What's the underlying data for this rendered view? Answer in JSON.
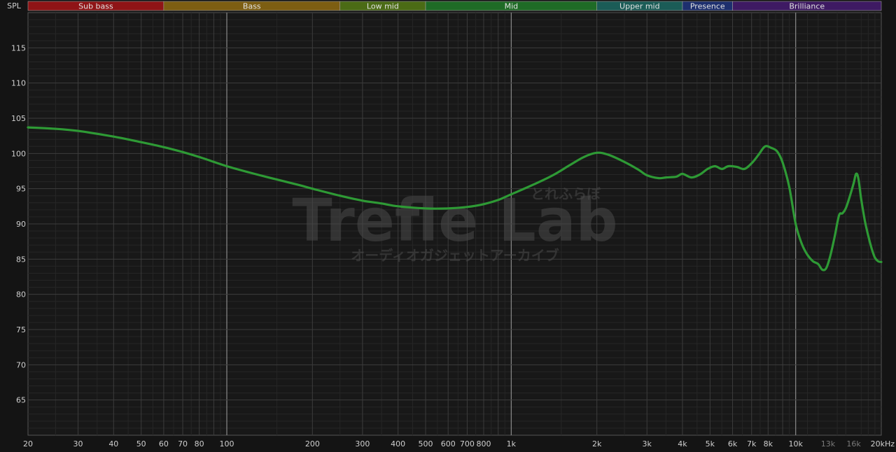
{
  "colors": {
    "background": "#141414",
    "plot_background": "#181818",
    "grid_major": "#3c3c3c",
    "grid_minor": "#262626",
    "decade_line": "#8a8a8a",
    "axis_text": "#cfcfcf",
    "curve": "#2e9a35",
    "watermark": "#4a4a4a"
  },
  "watermark": {
    "title": "Trefle Lab",
    "kana_top": "とれふらぼ",
    "kana_bottom": "オーディオガジェットアーカイブ"
  },
  "bands": [
    {
      "label": "Sub bass",
      "from": 20,
      "to": 60,
      "color": "#8f1416"
    },
    {
      "label": "Bass",
      "from": 60,
      "to": 250,
      "color": "#7d5e12"
    },
    {
      "label": "Low mid",
      "from": 250,
      "to": 500,
      "color": "#4b6b15"
    },
    {
      "label": "Mid",
      "from": 500,
      "to": 2000,
      "color": "#1f6b26"
    },
    {
      "label": "Upper mid",
      "from": 2000,
      "to": 4000,
      "color": "#1b5c57"
    },
    {
      "label": "Presence",
      "from": 4000,
      "to": 6000,
      "color": "#1d2f6e"
    },
    {
      "label": "Brilliance",
      "from": 6000,
      "to": 20000,
      "color": "#3e1a63"
    }
  ],
  "chart_data": {
    "type": "line",
    "title": "",
    "xlabel": "",
    "ylabel": "SPL",
    "x_scale": "log",
    "xlim": [
      20,
      20000
    ],
    "ylim": [
      60,
      120
    ],
    "grid": true,
    "legend": "none",
    "y_ticks": [
      65,
      70,
      75,
      80,
      85,
      90,
      95,
      100,
      105,
      110,
      115
    ],
    "x_ticks": [
      {
        "value": 20,
        "label": "20"
      },
      {
        "value": 30,
        "label": "30"
      },
      {
        "value": 40,
        "label": "40"
      },
      {
        "value": 50,
        "label": "50"
      },
      {
        "value": 60,
        "label": "60"
      },
      {
        "value": 70,
        "label": "70"
      },
      {
        "value": 80,
        "label": "80"
      },
      {
        "value": 100,
        "label": "100"
      },
      {
        "value": 200,
        "label": "200"
      },
      {
        "value": 300,
        "label": "300"
      },
      {
        "value": 400,
        "label": "400"
      },
      {
        "value": 500,
        "label": "500"
      },
      {
        "value": 600,
        "label": "600"
      },
      {
        "value": 700,
        "label": "700"
      },
      {
        "value": 800,
        "label": "800"
      },
      {
        "value": 1000,
        "label": "1k"
      },
      {
        "value": 2000,
        "label": "2k"
      },
      {
        "value": 3000,
        "label": "3k"
      },
      {
        "value": 4000,
        "label": "4k"
      },
      {
        "value": 5000,
        "label": "5k"
      },
      {
        "value": 6000,
        "label": "6k"
      },
      {
        "value": 7000,
        "label": "7k"
      },
      {
        "value": 8000,
        "label": "8k"
      },
      {
        "value": 10000,
        "label": "10k"
      },
      {
        "value": 13000,
        "label": "13k",
        "dim": true
      },
      {
        "value": 16000,
        "label": "16k",
        "dim": true
      },
      {
        "value": 20000,
        "label": "20kHz"
      }
    ],
    "series": [
      {
        "x": [
          20,
          25,
          30,
          40,
          50,
          60,
          70,
          80,
          100,
          120,
          150,
          180,
          200,
          250,
          300,
          350,
          400,
          500,
          600,
          700,
          800,
          900,
          1000,
          1200,
          1400,
          1600,
          1800,
          2000,
          2200,
          2500,
          2800,
          3000,
          3300,
          3500,
          3800,
          4000,
          4300,
          4600,
          4900,
          5200,
          5500,
          5800,
          6200,
          6600,
          7000,
          7400,
          7800,
          8200,
          8600,
          9000,
          9500,
          10000,
          10500,
          11000,
          11500,
          12000,
          12400,
          12800,
          13200,
          13700,
          14200,
          14600,
          15000,
          15500,
          16000,
          16300,
          16600,
          17000,
          17500,
          18000,
          18500,
          19000,
          19500,
          20000
        ],
        "y": [
          103.7,
          103.5,
          103.2,
          102.4,
          101.6,
          100.9,
          100.2,
          99.5,
          98.2,
          97.3,
          96.3,
          95.5,
          95.0,
          94.0,
          93.3,
          92.9,
          92.5,
          92.2,
          92.2,
          92.4,
          92.8,
          93.4,
          94.2,
          95.6,
          96.9,
          98.3,
          99.5,
          100.1,
          99.8,
          98.8,
          97.7,
          96.9,
          96.5,
          96.6,
          96.7,
          97.1,
          96.6,
          97.0,
          97.8,
          98.2,
          97.8,
          98.2,
          98.1,
          97.8,
          98.6,
          99.8,
          101.0,
          100.8,
          100.3,
          98.7,
          95.2,
          90.0,
          87.2,
          85.6,
          84.7,
          84.3,
          83.5,
          83.7,
          85.3,
          88.1,
          91.2,
          91.5,
          92.2,
          93.9,
          95.8,
          97.1,
          96.5,
          93.5,
          90.5,
          88.3,
          86.5,
          85.2,
          84.7,
          84.6
        ]
      }
    ]
  }
}
